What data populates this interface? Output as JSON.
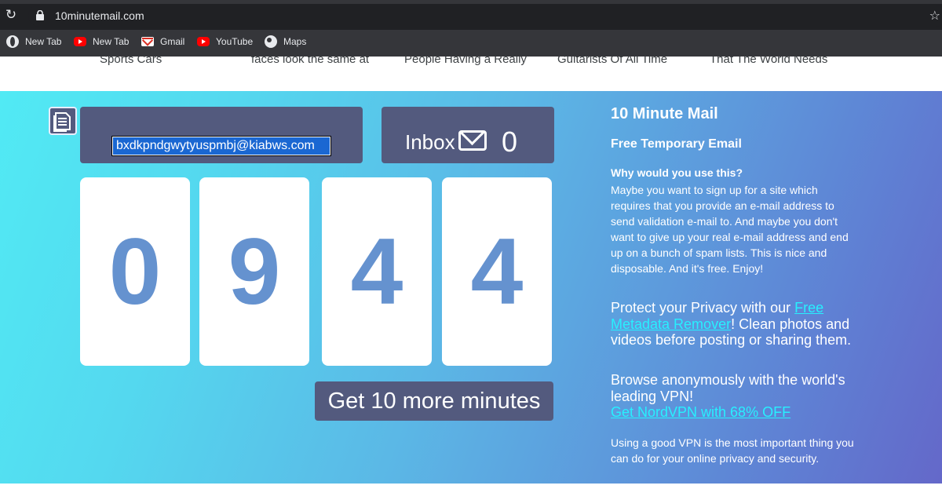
{
  "browser": {
    "url": "10minutemail.com",
    "bookmarks": [
      {
        "label": "New Tab",
        "icon": "globe-icon"
      },
      {
        "label": "New Tab",
        "icon": "youtube-icon"
      },
      {
        "label": "Gmail",
        "icon": "gmail-icon"
      },
      {
        "label": "YouTube",
        "icon": "youtube-icon"
      },
      {
        "label": "Maps",
        "icon": "globe-icon"
      }
    ]
  },
  "ticker": [
    "Sports Cars",
    "faces look the same at",
    "People Having a Really",
    "Guitarists Of All Time",
    "That The World Needs"
  ],
  "mail": {
    "address": "bxdkpndgwytyuspmbj@kiabws.com",
    "inbox_label": "Inbox",
    "inbox_count": "0",
    "timer": [
      "0",
      "9",
      "4",
      "4"
    ],
    "more_button": "Get 10 more minutes"
  },
  "side": {
    "title": "10 Minute Mail",
    "subtitle": "Free Temporary Email",
    "why_heading": "Why would you use this?",
    "why_body": "Maybe you want to sign up for a site which requires that you provide an e-mail address to send validation e-mail to. And maybe you don't want to give up your real e-mail address and end up on a bunch of spam lists. This is nice and disposable. And it's free. Enjoy!",
    "privacy_pre": "Protect your Privacy with our ",
    "privacy_link": "Free Metadata Remover",
    "privacy_post": "! Clean photos and videos before posting or sharing them.",
    "vpn_text": "Browse anonymously with the world's leading VPN!",
    "vpn_link": "Get NordVPN with 68% OFF",
    "using_text": "Using a good VPN is the most important thing you can do for your online privacy and security."
  },
  "colors": {
    "panel": "#535a7e",
    "digit_text": "#6592cf",
    "link": "#27f0ff"
  }
}
